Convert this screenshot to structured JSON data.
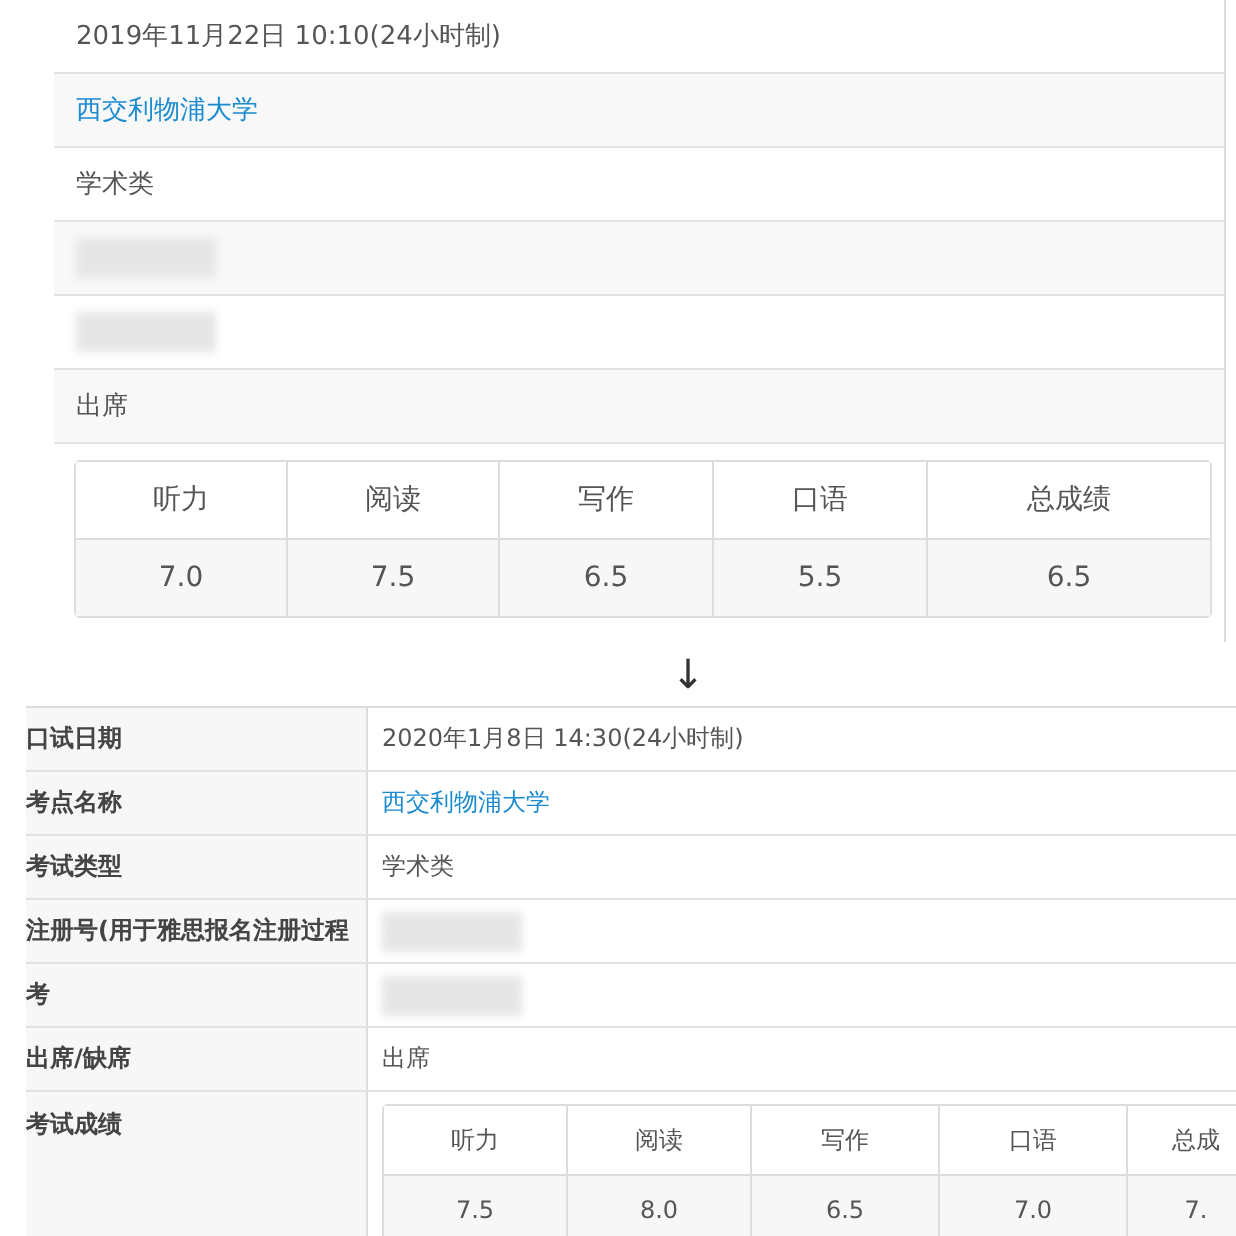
{
  "before": {
    "rows": [
      {
        "kind": "text",
        "value": "2019年11月22日 10:10(24小时制)"
      },
      {
        "kind": "link",
        "value": "西交利物浦大学"
      },
      {
        "kind": "text",
        "value": "学术类"
      },
      {
        "kind": "blurred"
      },
      {
        "kind": "blurred"
      },
      {
        "kind": "text",
        "value": "出席"
      }
    ],
    "scores": {
      "columns": [
        "听力",
        "阅读",
        "写作",
        "口语",
        "总成绩"
      ],
      "values": [
        "7.0",
        "7.5",
        "6.5",
        "5.5",
        "6.5"
      ]
    }
  },
  "arrow": "↓",
  "after": {
    "rows": [
      {
        "label": "口试日期",
        "kind": "text",
        "value": "2020年1月8日 14:30(24小时制)"
      },
      {
        "label": "考点名称",
        "kind": "link",
        "value": "西交利物浦大学"
      },
      {
        "label": "考试类型",
        "kind": "text",
        "value": "学术类"
      },
      {
        "label": "注册号(用于雅思报名注册过程",
        "kind": "blurred"
      },
      {
        "label": "考",
        "kind": "blurred"
      },
      {
        "label": "出席/缺席",
        "kind": "text",
        "value": "出席"
      }
    ],
    "scores_label": "考试成绩",
    "scores": {
      "columns": [
        "听力",
        "阅读",
        "写作",
        "口语",
        "总成"
      ],
      "values": [
        "7.5",
        "8.0",
        "6.5",
        "7.0",
        "7."
      ]
    }
  }
}
